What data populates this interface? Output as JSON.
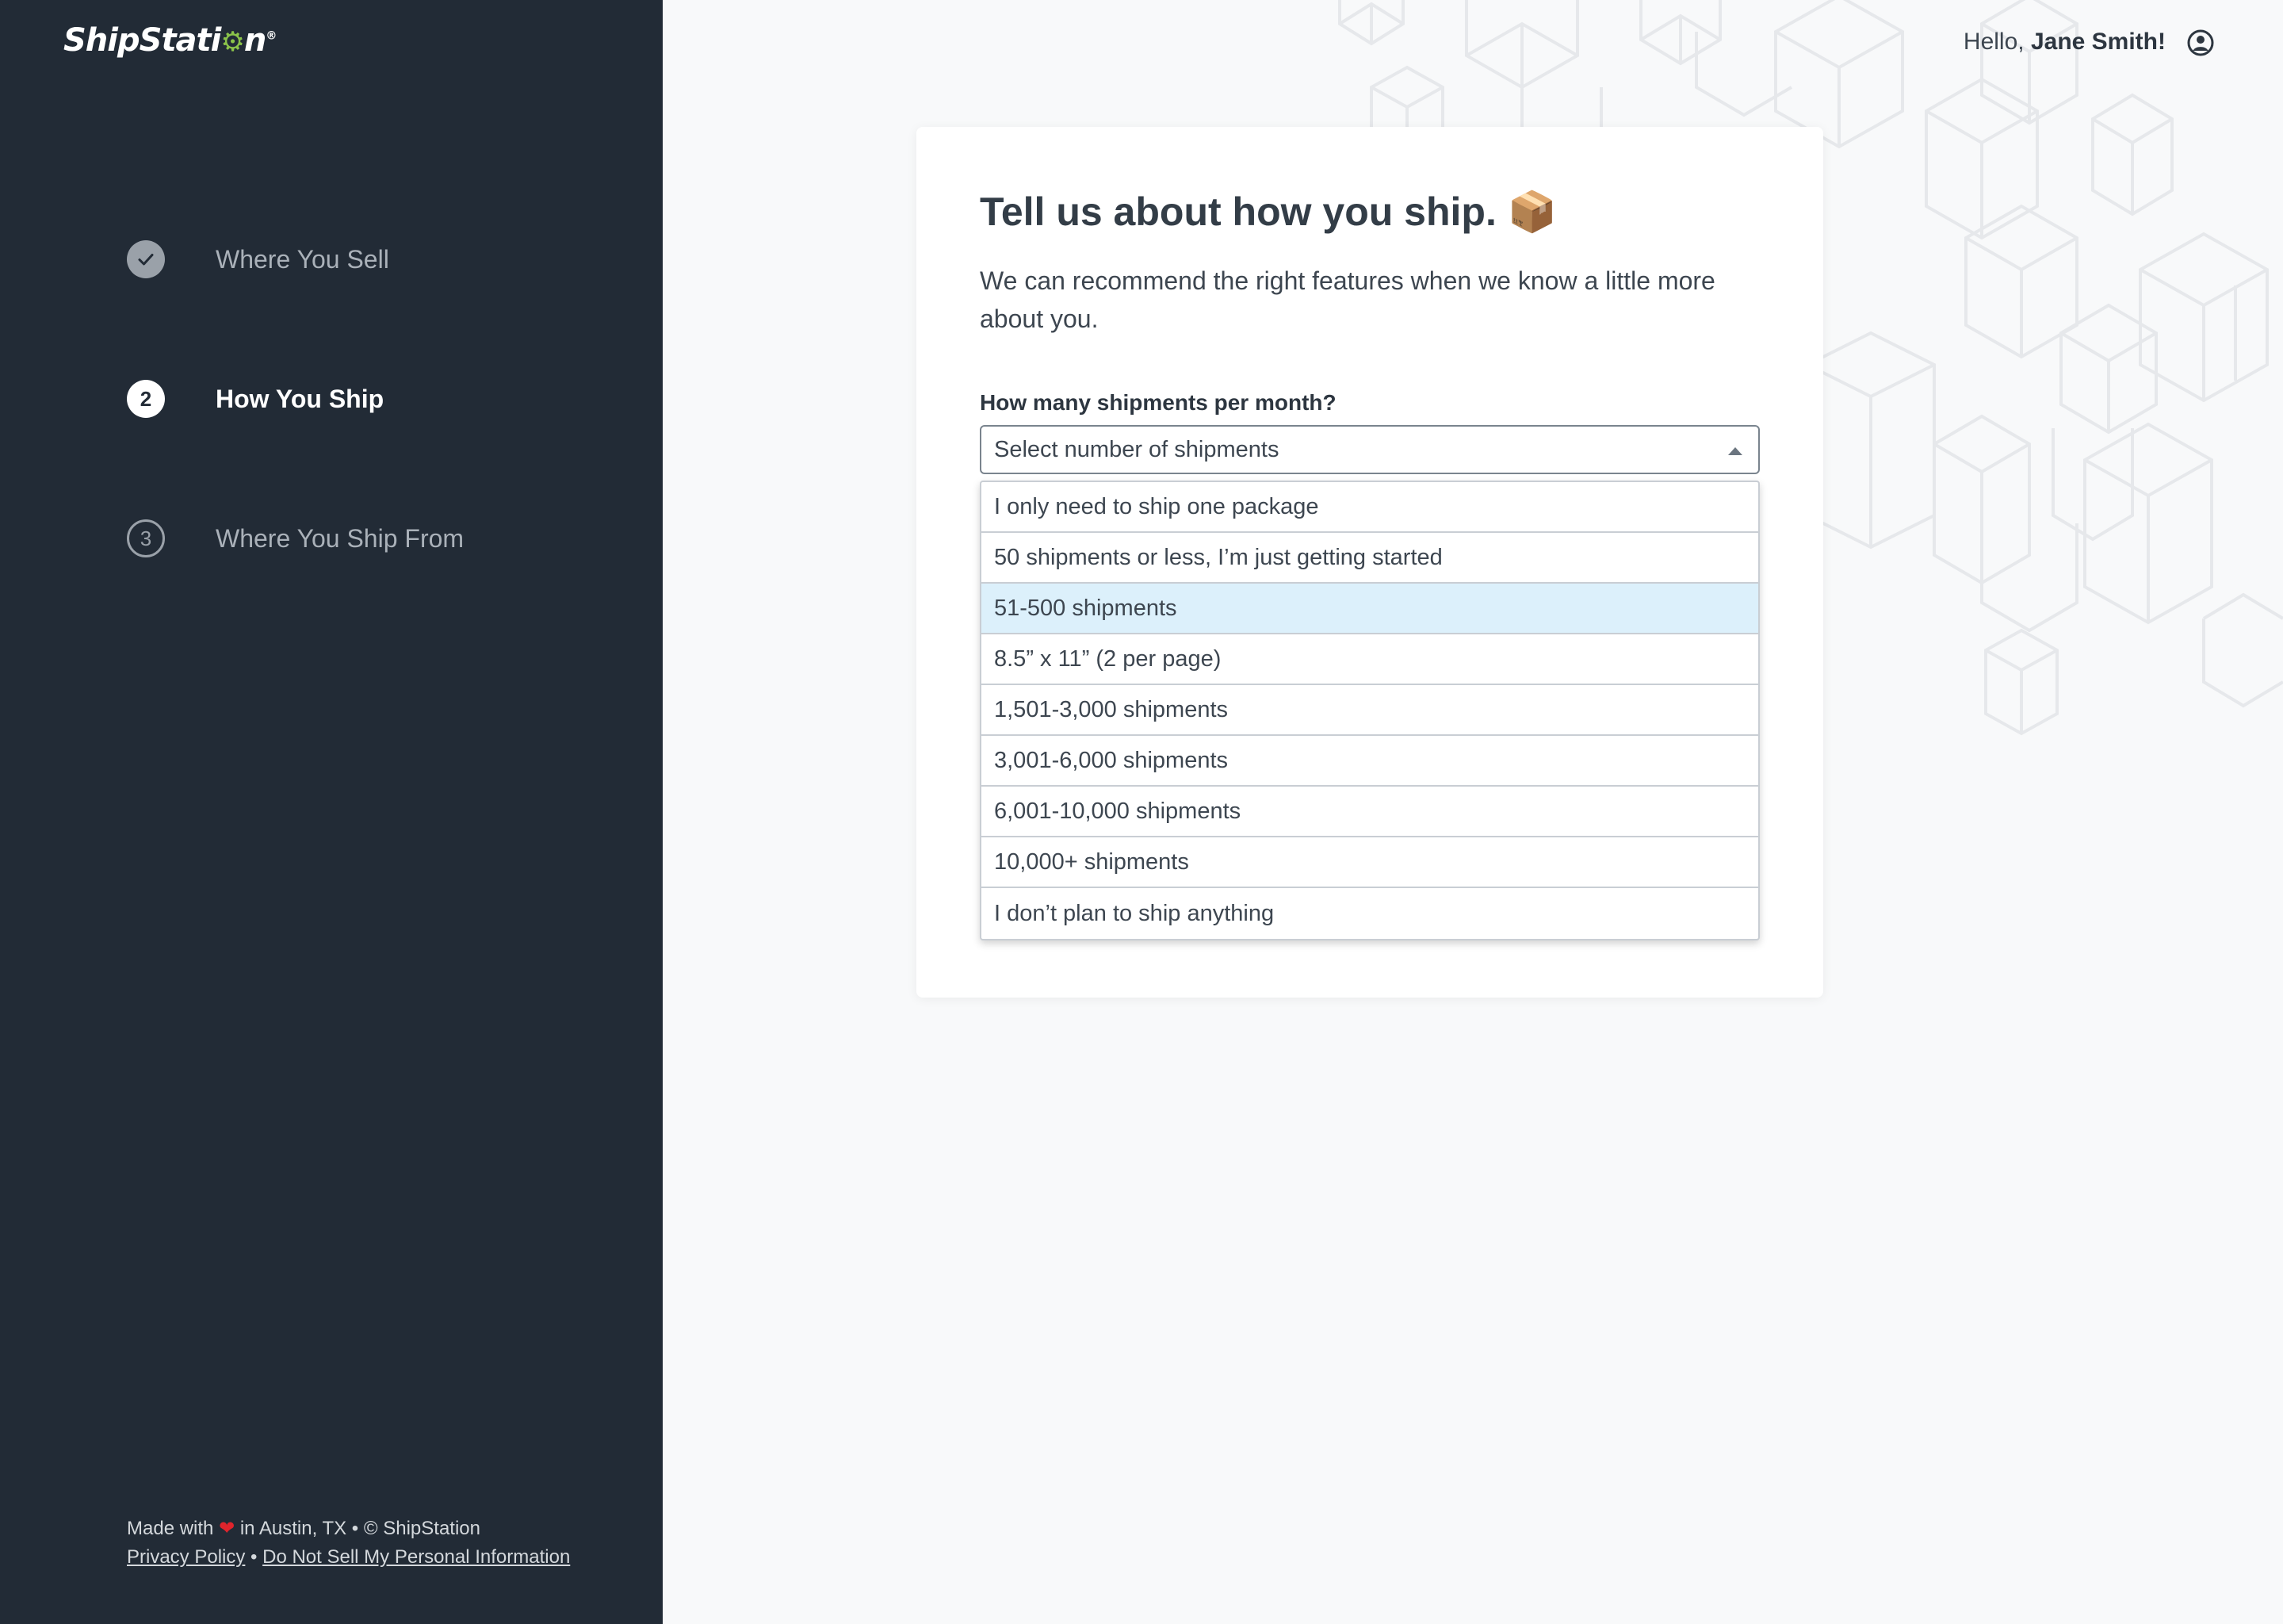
{
  "brand": {
    "name": "ShipStation"
  },
  "steps": [
    {
      "number": "",
      "label": "Where You Sell",
      "state": "done",
      "icon": "check-icon"
    },
    {
      "number": "2",
      "label": "How You Ship",
      "state": "current"
    },
    {
      "number": "3",
      "label": "Where You Ship From",
      "state": "todo"
    }
  ],
  "footer": {
    "made_with": "Made with",
    "heart": "❤",
    "location": "in Austin, TX • © ShipStation",
    "privacy": "Privacy Policy",
    "separator": "•",
    "do_not_sell": "Do Not Sell My Personal Information"
  },
  "header": {
    "hello": "Hello,",
    "user_name": "Jane Smith!",
    "account_icon": "user-circle-icon"
  },
  "card": {
    "title": "Tell us about how you ship.",
    "title_emoji": "📦",
    "subtitle": "We can recommend the right features when we know a little more about you.",
    "field_label": "How many shipments per month?",
    "select_placeholder": "Select number of shipments",
    "options": [
      "I only need to ship one package",
      "50 shipments or less, I’m just getting started",
      "51-500 shipments",
      "8.5” x 11” (2 per page)",
      "1,501-3,000 shipments",
      "3,001-6,000 shipments",
      "6,001-10,000 shipments",
      "10,000+ shipments",
      "I don’t plan to ship anything"
    ],
    "highlighted_option_index": 2
  },
  "colors": {
    "sidebar_bg": "#222b36",
    "page_bg": "#f8f9fa",
    "highlight": "#dcf0fb",
    "brand_gear": "#8bc34a"
  }
}
